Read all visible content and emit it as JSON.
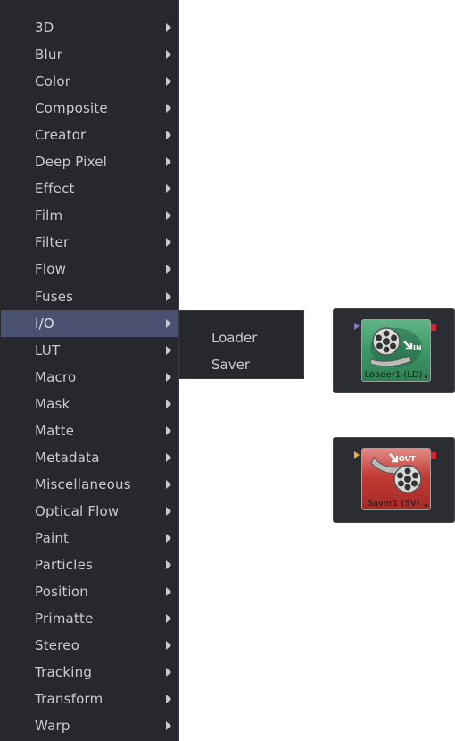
{
  "menu": {
    "items": [
      {
        "label": "3D"
      },
      {
        "label": "Blur"
      },
      {
        "label": "Color"
      },
      {
        "label": "Composite"
      },
      {
        "label": "Creator"
      },
      {
        "label": "Deep Pixel"
      },
      {
        "label": "Effect"
      },
      {
        "label": "Film"
      },
      {
        "label": "Filter"
      },
      {
        "label": "Flow"
      },
      {
        "label": "Fuses"
      },
      {
        "label": "I/O"
      },
      {
        "label": "LUT"
      },
      {
        "label": "Macro"
      },
      {
        "label": "Mask"
      },
      {
        "label": "Matte"
      },
      {
        "label": "Metadata"
      },
      {
        "label": "Miscellaneous"
      },
      {
        "label": "Optical Flow"
      },
      {
        "label": "Paint"
      },
      {
        "label": "Particles"
      },
      {
        "label": "Position"
      },
      {
        "label": "Primatte"
      },
      {
        "label": "Stereo"
      },
      {
        "label": "Tracking"
      },
      {
        "label": "Transform"
      },
      {
        "label": "Warp"
      }
    ],
    "active_item": "I/O"
  },
  "submenu": {
    "items": [
      {
        "label": "Loader"
      },
      {
        "label": "Saver"
      }
    ]
  },
  "nodes": {
    "loader": {
      "label": "Loader1  (LD)",
      "badge": "IN",
      "color": "#3f9a68",
      "icon": "film-reel-icon"
    },
    "saver": {
      "label": "Saver1  (SV)",
      "badge": "OUT",
      "color": "#c23a35",
      "icon": "film-reel-icon"
    }
  },
  "colors": {
    "menu_bg": "#26282d",
    "menu_highlight": "#4a5170",
    "node_panel_bg": "#2b2d32",
    "input_port": "#7b76d6",
    "saver_input_port": "#e7b820",
    "output_port": "#d8262b"
  }
}
